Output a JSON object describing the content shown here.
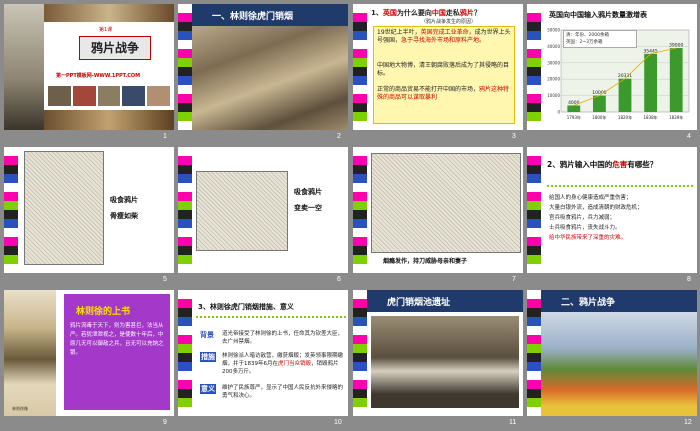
{
  "slides": [
    {
      "n": "1",
      "lesson": "第1课",
      "title": "鸦片战争",
      "footer": "第一PPT模板网-WWW.1PPT.COM"
    },
    {
      "n": "2",
      "title": "一、林则徐虎门销烟"
    },
    {
      "n": "3",
      "heading_prefix": "1、",
      "heading_red1": "英国",
      "heading_mid": "为什么要向",
      "heading_red2": "中国",
      "heading_mid2": "走私",
      "heading_red3": "鸦片",
      "heading_end": "？",
      "sub": "（鸦片战争发生的原因）",
      "p1a": "19世纪上半叶，",
      "p1b": "英国完成工业革命",
      "p1c": "，成为世界上头号强国，",
      "p1d": "急于寻找海外市场和原料产地。",
      "p2": "中国地大物博，清王朝腐败落后成为了其侵略的目标。",
      "p3a": "正常的商品贸易不能打开中国的市场，",
      "p3b": "鸦片这种特殊的商品可以谋取暴利"
    },
    {
      "n": "4",
      "title": "英国向中国输入鸦片数量激增表",
      "legend1": "清：年份、2000余箱",
      "legend2": "英国：2~3万余箱",
      "values": [
        "4000",
        "10000",
        "20331",
        "35445",
        "39000"
      ],
      "years": [
        "1793年",
        "1800年",
        "1820年",
        "1838年",
        "1839年"
      ]
    },
    {
      "n": "5",
      "cap1": "吸食鸦片",
      "cap2": "骨瘦如柴"
    },
    {
      "n": "6",
      "cap1": "吸食鸦片",
      "cap2": "变卖一空"
    },
    {
      "n": "7",
      "cap": "烟瘾发作，持刀威胁母亲和妻子"
    },
    {
      "n": "8",
      "heading_a": "2、鸦片输入中国的",
      "heading_b": "危害",
      "heading_c": "有哪些？",
      "items": [
        "给国人的身心健康造成严重伤害；",
        "大量白银外流，造成清朝的财政危机；",
        "官兵吸食鸦片，兵力减弱；",
        "士兵吸食鸦片，丧失战斗力。"
      ],
      "conclusion": "给中华民族带来了深重的灾难。"
    },
    {
      "n": "9",
      "title": "林则徐的上书",
      "body": "鸦片流毒于天下，则为害甚巨，法当从严。若犹泄泄视之，是使数十年后，中原几无可以御敌之兵，且无可以充饷之银。",
      "portrait_label": "林则徐像"
    },
    {
      "n": "10",
      "title": "3、林则徐虎门销烟措施、意义",
      "l1": "背景",
      "t1": "道光帝接受了林则徐的上书，任命其为钦差大臣，去广州禁烟。",
      "l2": "措施",
      "t2a": "林则徐派人暗访敌营，缴获烟贩；发英领事限期缴烟，并于1839年6月在",
      "t2b": "虎门当众销毁",
      "t2c": "，销毁鸦片200多万斤。",
      "l3": "意义",
      "t3": "维护了民族尊严，显示了中国人民反抗外来侵略的勇气和决心。"
    },
    {
      "n": "11",
      "title": "虎门销烟池遗址"
    },
    {
      "n": "12",
      "title": "二、鸦片战争"
    }
  ],
  "chart_data": {
    "type": "bar",
    "title": "英国向中国输入鸦片数量激增表",
    "categories": [
      "1793年",
      "1800年",
      "1820年",
      "1838年",
      "1839年"
    ],
    "values": [
      4000,
      10000,
      20331,
      35445,
      39000
    ],
    "ylim": [
      0,
      50000
    ]
  }
}
